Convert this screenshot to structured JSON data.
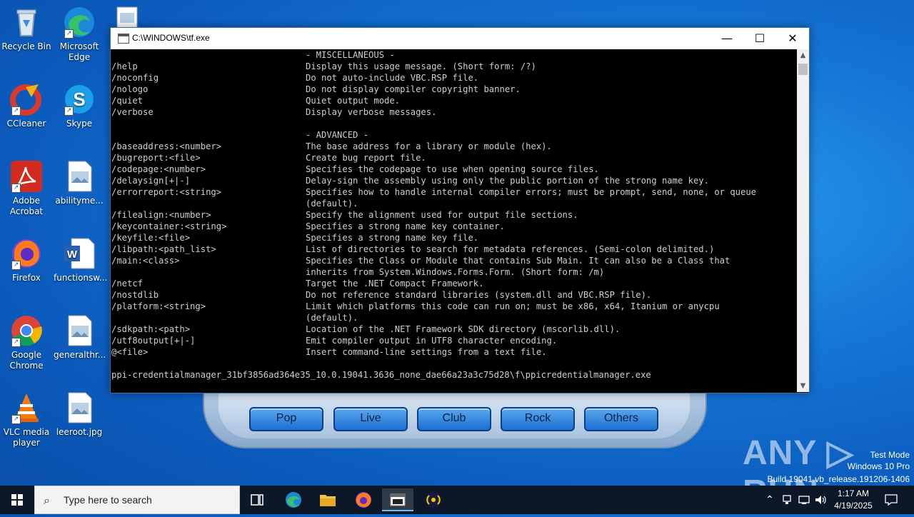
{
  "desktop": {
    "icons": [
      {
        "label": "Recycle Bin"
      },
      {
        "label": "Microsoft Edge"
      },
      {
        "label": "CCleaner"
      },
      {
        "label": "Skype"
      },
      {
        "label": "Adobe Acrobat"
      },
      {
        "label": "abilityme..."
      },
      {
        "label": "Firefox"
      },
      {
        "label": "functionsw..."
      },
      {
        "label": "Google Chrome"
      },
      {
        "label": "generalthr..."
      },
      {
        "label": "VLC media player"
      },
      {
        "label": "leeroot.jpg"
      }
    ]
  },
  "player": {
    "buttons": [
      "Pop",
      "Live",
      "Club",
      "Rock",
      "Others"
    ]
  },
  "console_window": {
    "title": "C:\\WINDOWS\\tf.exe",
    "minimize": "—",
    "maximize": "☐",
    "close": "✕",
    "lines": [
      {
        "cmd": "",
        "desc": "- MISCELLANEOUS -"
      },
      {
        "cmd": "/help",
        "desc": "Display this usage message. (Short form: /?)"
      },
      {
        "cmd": "/noconfig",
        "desc": "Do not auto-include VBC.RSP file."
      },
      {
        "cmd": "/nologo",
        "desc": "Do not display compiler copyright banner."
      },
      {
        "cmd": "/quiet",
        "desc": "Quiet output mode."
      },
      {
        "cmd": "/verbose",
        "desc": "Display verbose messages."
      },
      {
        "cmd": "",
        "desc": ""
      },
      {
        "cmd": "",
        "desc": "- ADVANCED -"
      },
      {
        "cmd": "/baseaddress:<number>",
        "desc": "The base address for a library or module (hex)."
      },
      {
        "cmd": "/bugreport:<file>",
        "desc": "Create bug report file."
      },
      {
        "cmd": "/codepage:<number>",
        "desc": "Specifies the codepage to use when opening source files."
      },
      {
        "cmd": "/delaysign[+|-]",
        "desc": "Delay-sign the assembly using only the public portion of the strong name key."
      },
      {
        "cmd": "/errorreport:<string>",
        "desc": "Specifies how to handle internal compiler errors; must be prompt, send, none, or queue"
      },
      {
        "cmd": "",
        "desc": "(default)."
      },
      {
        "cmd": "/filealign:<number>",
        "desc": "Specify the alignment used for output file sections."
      },
      {
        "cmd": "/keycontainer:<string>",
        "desc": "Specifies a strong name key container."
      },
      {
        "cmd": "/keyfile:<file>",
        "desc": "Specifies a strong name key file."
      },
      {
        "cmd": "/libpath:<path_list>",
        "desc": "List of directories to search for metadata references. (Semi-colon delimited.)"
      },
      {
        "cmd": "/main:<class>",
        "desc": "Specifies the Class or Module that contains Sub Main. It can also be a Class that"
      },
      {
        "cmd": "",
        "desc": "inherits from System.Windows.Forms.Form. (Short form: /m)"
      },
      {
        "cmd": "/netcf",
        "desc": "Target the .NET Compact Framework."
      },
      {
        "cmd": "/nostdlib",
        "desc": "Do not reference standard libraries (system.dll and VBC.RSP file)."
      },
      {
        "cmd": "/platform:<string>",
        "desc": "Limit which platforms this code can run on; must be x86, x64, Itanium or anycpu"
      },
      {
        "cmd": "",
        "desc": "(default)."
      },
      {
        "cmd": "/sdkpath:<path>",
        "desc": "Location of the .NET Framework SDK directory (mscorlib.dll)."
      },
      {
        "cmd": "/utf8output[+|-]",
        "desc": "Emit compiler output in UTF8 character encoding."
      },
      {
        "cmd": "@<file>",
        "desc": "Insert command-line settings from a text file."
      },
      {
        "cmd": "",
        "desc": ""
      },
      {
        "cmd": "ppi-credentialmanager_31bf3856ad364e35_10.0.19041.3636_none_dae66a23a3c75d28\\f\\ppicredentialmanager.exe",
        "desc": ""
      }
    ]
  },
  "watermark": {
    "logo": "ANY ▷ RUN",
    "line1": "Test Mode",
    "line2": "Windows 10 Pro",
    "line3": "Build 19041.vb_release.191206-1406"
  },
  "taskbar": {
    "search_placeholder": "Type here to search",
    "time": "1:17 AM",
    "date": "4/19/2025"
  }
}
